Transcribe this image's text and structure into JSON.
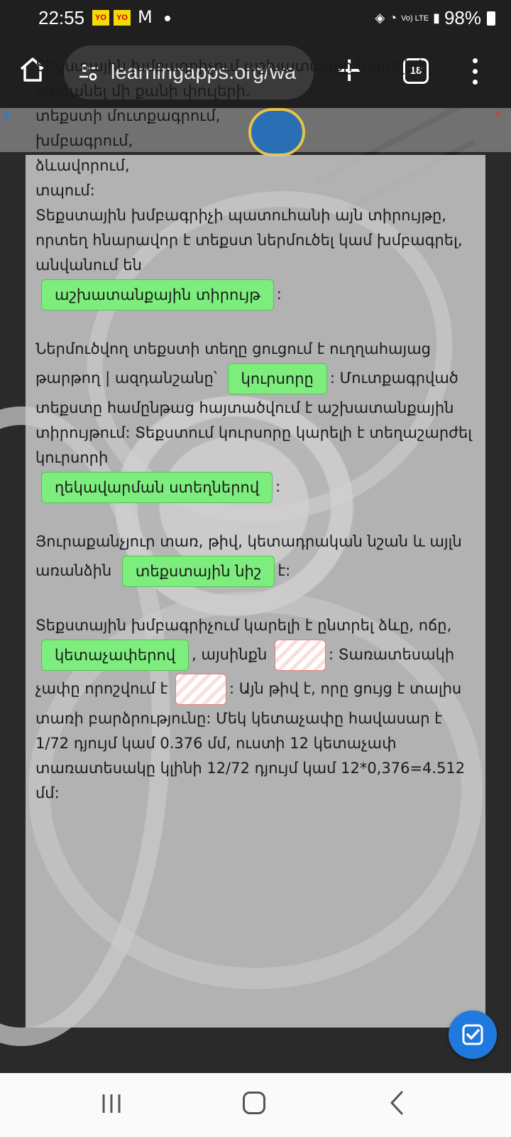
{
  "status": {
    "time": "22:55",
    "notif_badge_1": "YO",
    "notif_badge_2": "YO",
    "network_label": "Vo) LTE",
    "battery": "98%"
  },
  "browser": {
    "url": "learningapps.org/wa",
    "tab_count": "18"
  },
  "exercise": {
    "p1": {
      "t1": "Տեքստային խմբագրիչում աշխատանքը կարելի է բաժանել մի քանի փուլերի.",
      "t2": "տեքստի մուտքագրում,",
      "t3": "խմբագրում,",
      "t4": "ձևավորում,",
      "t5": "տպում:",
      "t6": "Տեքստային խմբագրիչի պատուհանի այն տիրույթը, որտեղ հնարավոր է տեքստ ներմուծել կամ խմբագրել, անվանում են",
      "chip": "աշխատանքային տիրույթ",
      "end": ":"
    },
    "p2": {
      "t1": "Ներմուծվող տեքստի տեղը ցուցում է ուղղահայաց թարթող | ազդանշանը՝",
      "chip1": "կուրսորը",
      "t2": ": Մուտքագրված տեքստը համընթաց հայտածվում է աշխատանքային տիրույթում: Տեքստում կուրսորը կարելի է տեղաշարժել կուրսորի",
      "chip2": "ղեկավարման ստեղներով",
      "end": ":"
    },
    "p3": {
      "t1": "Յուրաքանչյուր տառ, թիվ, կետադրական նշան և այլն առանձին",
      "chip": "տեքստային նիշ",
      "end": "է:"
    },
    "p4": {
      "t1": "Տեքստային խմբագրիչում կարելի է ընտրել ձևը, ոճը,",
      "chip": "կետաչափերով",
      "t2": ", այսինքն",
      "t3": ": Տառատեսակի չափը որոշվում է",
      "t4": ": Այն թիվ է, որը ցույց է տալիս տառի բարձրությունը: Մեկ կետաչափը հավասար է 1/72 դյույմ կամ 0.376 մմ, ուստի 12 կետաչափ տառատեսակը կլինի 12/72 դյույմ կամ 12*0,376=4.512 մմ:"
    }
  },
  "icons": [
    "home-icon",
    "site-settings-icon",
    "new-tab-icon",
    "tab-switcher-icon",
    "more-menu-icon",
    "help-icon",
    "fullscreen-icon",
    "check-icon",
    "recent-apps-icon",
    "home-nav-icon",
    "back-icon"
  ],
  "colors": {
    "chip": "#7ded7d",
    "fab": "#1f7ae0",
    "bar": "#1f1f1f"
  }
}
